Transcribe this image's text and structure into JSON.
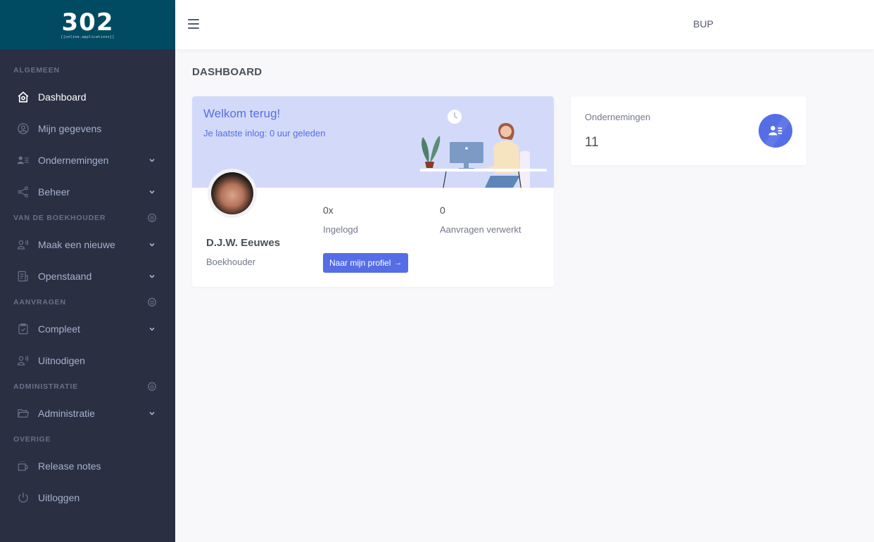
{
  "brand": {
    "logo_text": "302",
    "tagline": "[[online.applications]]",
    "color": "#004a62"
  },
  "sidebar": {
    "sections": [
      {
        "title": "ALGEMEEN",
        "items": [
          {
            "label": "Dashboard",
            "icon": "home-icon",
            "active": true
          },
          {
            "label": "Mijn gegevens",
            "icon": "user-circle-icon"
          },
          {
            "label": "Ondernemingen",
            "icon": "user-list-icon",
            "expandable": true
          },
          {
            "label": "Beheer",
            "icon": "share-icon",
            "expandable": true
          }
        ]
      },
      {
        "title": "VAN DE BOEKHOUDER",
        "settings_icon": "gear-icon",
        "items": [
          {
            "label": "Maak een nieuwe",
            "icon": "user-voice-icon",
            "expandable": true
          },
          {
            "label": "Openstaand",
            "icon": "document-icon",
            "expandable": true
          }
        ]
      },
      {
        "title": "AANVRAGEN",
        "settings_icon": "gear-icon",
        "items": [
          {
            "label": "Compleet",
            "icon": "clipboard-check-icon",
            "expandable": true
          },
          {
            "label": "Uitnodigen",
            "icon": "user-voice-icon"
          }
        ]
      },
      {
        "title": "ADMINISTRATIE",
        "settings_icon": "gear-icon",
        "items": [
          {
            "label": "Administratie",
            "icon": "folder-open-icon",
            "expandable": true
          }
        ]
      },
      {
        "title": "OVERIGE",
        "items": [
          {
            "label": "Release notes",
            "icon": "coffee-cup-icon"
          },
          {
            "label": "Uitloggen",
            "icon": "power-icon"
          }
        ]
      }
    ]
  },
  "topbar": {
    "menu_icon": "hamburger-icon",
    "user_label": "BUP"
  },
  "page": {
    "title": "DASHBOARD"
  },
  "welcome_card": {
    "title": "Welkom terug!",
    "subtitle": "Je laatste inlog: 0 uur geleden",
    "user_name": "D.J.W. Eeuwes",
    "user_role": "Boekhouder",
    "stats": [
      {
        "value": "0x",
        "label": "Ingelogd"
      },
      {
        "value": "0",
        "label": "Aanvragen verwerkt"
      }
    ],
    "profile_button": "Naar mijn profiel",
    "profile_button_arrow": "→"
  },
  "stat_card": {
    "title": "Ondernemingen",
    "count": "11",
    "icon": "user-list-icon",
    "accent_color": "#556ee6"
  }
}
